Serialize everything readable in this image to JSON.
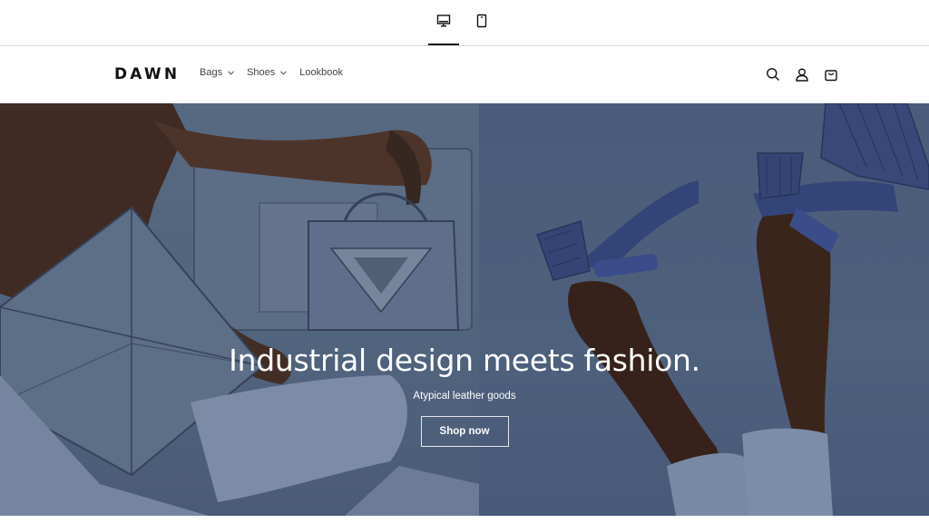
{
  "preview_bar": {
    "desktop_icon": "monitor-icon",
    "mobile_icon": "smartphone-icon"
  },
  "header": {
    "logo": "DAWN",
    "nav": [
      {
        "label": "Bags",
        "has_dropdown": true
      },
      {
        "label": "Shoes",
        "has_dropdown": true
      },
      {
        "label": "Lookbook",
        "has_dropdown": false
      }
    ],
    "icons": [
      "search-icon",
      "account-icon",
      "cart-icon"
    ]
  },
  "hero": {
    "title": "Industrial design meets fashion.",
    "subtitle": "Atypical leather goods",
    "button_label": "Shop now"
  },
  "colors": {
    "text": "#121212",
    "hero_bg": "#5e7390",
    "white": "#ffffff"
  }
}
